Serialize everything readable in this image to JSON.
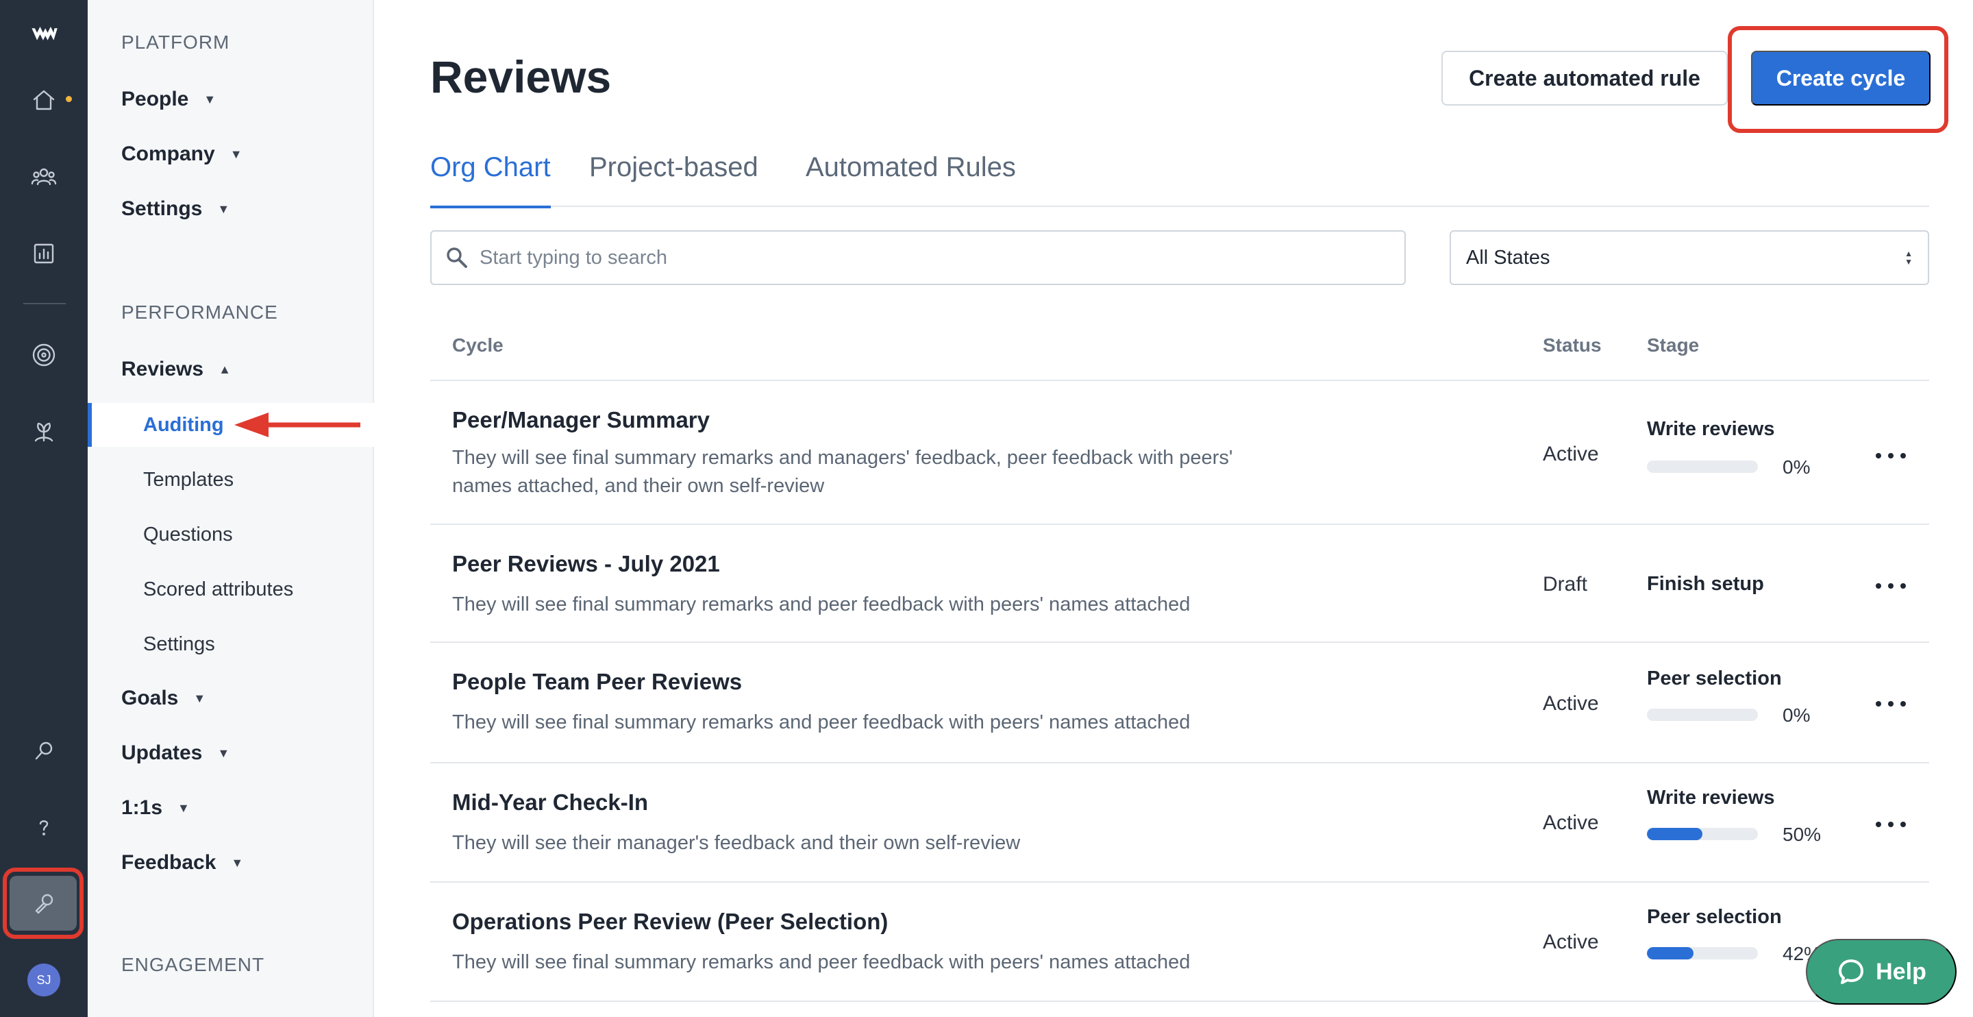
{
  "sidebar": {
    "platform_header": "PLATFORM",
    "platform_items": [
      {
        "label": "People"
      },
      {
        "label": "Company"
      },
      {
        "label": "Settings"
      }
    ],
    "performance_header": "PERFORMANCE",
    "reviews_label": "Reviews",
    "reviews_sub": [
      {
        "label": "Auditing",
        "active": true
      },
      {
        "label": "Templates"
      },
      {
        "label": "Questions"
      },
      {
        "label": "Scored attributes"
      },
      {
        "label": "Settings"
      }
    ],
    "performance_items": [
      {
        "label": "Goals"
      },
      {
        "label": "Updates"
      },
      {
        "label": "1:1s"
      },
      {
        "label": "Feedback"
      }
    ],
    "engagement_header": "ENGAGEMENT"
  },
  "rail": {
    "avatar_initials": "SJ",
    "icons": [
      "logo-icon",
      "home-icon",
      "people-icon",
      "chart-icon",
      "target-icon",
      "plant-icon",
      "search-icon",
      "help-icon",
      "wrench-icon"
    ]
  },
  "header": {
    "title": "Reviews",
    "create_rule_label": "Create automated rule",
    "create_cycle_label": "Create cycle"
  },
  "tabs": [
    {
      "label": "Org Chart",
      "active": true
    },
    {
      "label": "Project-based"
    },
    {
      "label": "Automated Rules"
    }
  ],
  "search": {
    "placeholder": "Start typing to search",
    "value": ""
  },
  "state_filter": {
    "value": "All States"
  },
  "table": {
    "columns": {
      "cycle": "Cycle",
      "status": "Status",
      "stage": "Stage"
    },
    "rows": [
      {
        "name": "Peer/Manager Summary",
        "description": "They will see final summary remarks and managers' feedback, peer feedback with peers' names attached, and their own self-review",
        "status": "Active",
        "stage": "Write reviews",
        "progress": 0,
        "progress_label": "0%"
      },
      {
        "name": "Peer Reviews - July 2021",
        "description": "They will see final summary remarks and peer feedback with peers' names attached",
        "status": "Draft",
        "stage": "Finish setup",
        "progress": null,
        "progress_label": ""
      },
      {
        "name": "People Team Peer Reviews",
        "description": "They will see final summary remarks and peer feedback with peers' names attached",
        "status": "Active",
        "stage": "Peer selection",
        "progress": 0,
        "progress_label": "0%"
      },
      {
        "name": "Mid-Year Check-In",
        "description": "They will see their manager's feedback and their own self-review",
        "status": "Active",
        "stage": "Write reviews",
        "progress": 50,
        "progress_label": "50%"
      },
      {
        "name": "Operations Peer Review (Peer Selection)",
        "description": "They will see final summary remarks and peer feedback with peers' names attached",
        "status": "Active",
        "stage": "Peer selection",
        "progress": 42,
        "progress_label": "42%"
      }
    ]
  },
  "help_button": {
    "label": "Help"
  },
  "colors": {
    "accent": "#2a6fd6",
    "rail": "#26303d",
    "annotation": "#e03a2f",
    "help": "#3aa17e"
  }
}
